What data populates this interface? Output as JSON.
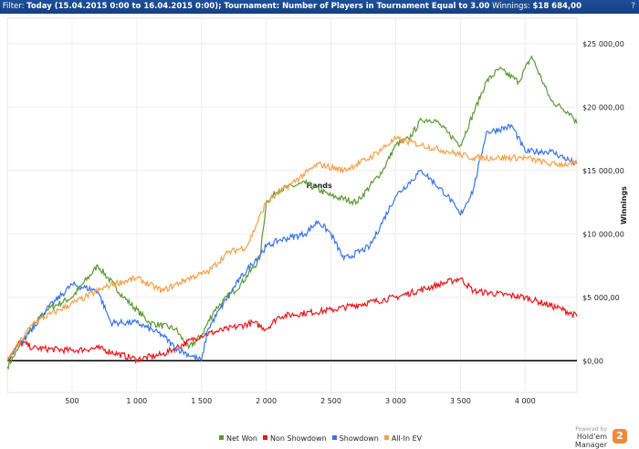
{
  "header": {
    "filter_label": "Filter:",
    "filter_text": "Today (15.04.2015 0:00 to 16.04.2015 0:00); Tournament: Number of Players in Tournament Equal to 3.00",
    "winnings_label": "Winnings:",
    "winnings_value": "$18 684,00",
    "help_icon": "?"
  },
  "branding": {
    "powered": "Powered by",
    "name": "Hold'em Manager",
    "logo": "2"
  },
  "chart_data": {
    "type": "line",
    "xlabel": "Hands",
    "ylabel": "Winnings",
    "xlim": [
      0,
      4400
    ],
    "ylim": [
      -2500,
      27000
    ],
    "xticks": [
      500,
      1000,
      1500,
      2000,
      2500,
      3000,
      3500,
      4000
    ],
    "xtick_labels": [
      "500",
      "1 000",
      "1 500",
      "2 000",
      "2 500",
      "3 000",
      "3 500",
      "4 000"
    ],
    "yticks": [
      0,
      5000,
      10000,
      15000,
      20000,
      25000
    ],
    "ytick_labels": [
      "$0,00",
      "$5 000,00",
      "$10 000,00",
      "$15 000,00",
      "$20 000,00",
      "$25 000,00"
    ],
    "legend_position": "bottom",
    "series": [
      {
        "name": "Net Won",
        "color": "#5a9a32",
        "points": [
          [
            0,
            -500
          ],
          [
            150,
            2000
          ],
          [
            300,
            4000
          ],
          [
            500,
            5000
          ],
          [
            700,
            7500
          ],
          [
            900,
            5000
          ],
          [
            1100,
            3000
          ],
          [
            1300,
            2500
          ],
          [
            1400,
            1000
          ],
          [
            1500,
            2000
          ],
          [
            1600,
            4000
          ],
          [
            1800,
            6000
          ],
          [
            1950,
            8000
          ],
          [
            2000,
            12500
          ],
          [
            2100,
            13500
          ],
          [
            2300,
            14000
          ],
          [
            2500,
            13000
          ],
          [
            2700,
            12500
          ],
          [
            2900,
            15000
          ],
          [
            3000,
            17000
          ],
          [
            3100,
            17500
          ],
          [
            3200,
            19000
          ],
          [
            3300,
            19000
          ],
          [
            3400,
            18000
          ],
          [
            3500,
            17000
          ],
          [
            3700,
            22000
          ],
          [
            3800,
            23000
          ],
          [
            3950,
            22000
          ],
          [
            4050,
            24000
          ],
          [
            4200,
            20500
          ],
          [
            4350,
            19500
          ],
          [
            4400,
            18700
          ]
        ]
      },
      {
        "name": "Non Showdown",
        "color": "#e8161b",
        "points": [
          [
            0,
            0
          ],
          [
            100,
            1500
          ],
          [
            200,
            1000
          ],
          [
            500,
            800
          ],
          [
            700,
            1000
          ],
          [
            1000,
            100
          ],
          [
            1200,
            500
          ],
          [
            1300,
            1000
          ],
          [
            1500,
            2000
          ],
          [
            1700,
            2500
          ],
          [
            1900,
            3000
          ],
          [
            2000,
            2500
          ],
          [
            2100,
            3500
          ],
          [
            2500,
            4000
          ],
          [
            3000,
            5000
          ],
          [
            3500,
            6500
          ],
          [
            3600,
            5500
          ],
          [
            4000,
            5000
          ],
          [
            4300,
            4000
          ],
          [
            4400,
            3500
          ]
        ]
      },
      {
        "name": "Showdown",
        "color": "#3a74e8",
        "points": [
          [
            0,
            0
          ],
          [
            150,
            2000
          ],
          [
            300,
            4000
          ],
          [
            500,
            6000
          ],
          [
            700,
            5500
          ],
          [
            800,
            3000
          ],
          [
            1000,
            3000
          ],
          [
            1200,
            2000
          ],
          [
            1300,
            1000
          ],
          [
            1500,
            0
          ],
          [
            1550,
            2500
          ],
          [
            1700,
            5000
          ],
          [
            1800,
            6500
          ],
          [
            2000,
            9000
          ],
          [
            2100,
            9500
          ],
          [
            2300,
            10000
          ],
          [
            2400,
            11000
          ],
          [
            2500,
            10000
          ],
          [
            2600,
            8000
          ],
          [
            2800,
            9000
          ],
          [
            3000,
            13000
          ],
          [
            3200,
            15000
          ],
          [
            3300,
            14000
          ],
          [
            3400,
            13000
          ],
          [
            3500,
            11500
          ],
          [
            3600,
            13500
          ],
          [
            3700,
            18000
          ],
          [
            3900,
            18500
          ],
          [
            4000,
            16500
          ],
          [
            4200,
            16500
          ],
          [
            4400,
            15500
          ]
        ]
      },
      {
        "name": "All-In EV",
        "color": "#f5a04a",
        "points": [
          [
            0,
            0
          ],
          [
            200,
            3000
          ],
          [
            400,
            4000
          ],
          [
            600,
            5000
          ],
          [
            800,
            6000
          ],
          [
            1000,
            6500
          ],
          [
            1200,
            5500
          ],
          [
            1400,
            6500
          ],
          [
            1550,
            7000
          ],
          [
            1700,
            8500
          ],
          [
            1850,
            9000
          ],
          [
            2000,
            12500
          ],
          [
            2200,
            14000
          ],
          [
            2400,
            15500
          ],
          [
            2600,
            15000
          ],
          [
            2800,
            16000
          ],
          [
            3000,
            17500
          ],
          [
            3200,
            17000
          ],
          [
            3400,
            16500
          ],
          [
            3600,
            16000
          ],
          [
            3800,
            16000
          ],
          [
            4000,
            16000
          ],
          [
            4200,
            15500
          ],
          [
            4400,
            15500
          ]
        ]
      }
    ]
  }
}
